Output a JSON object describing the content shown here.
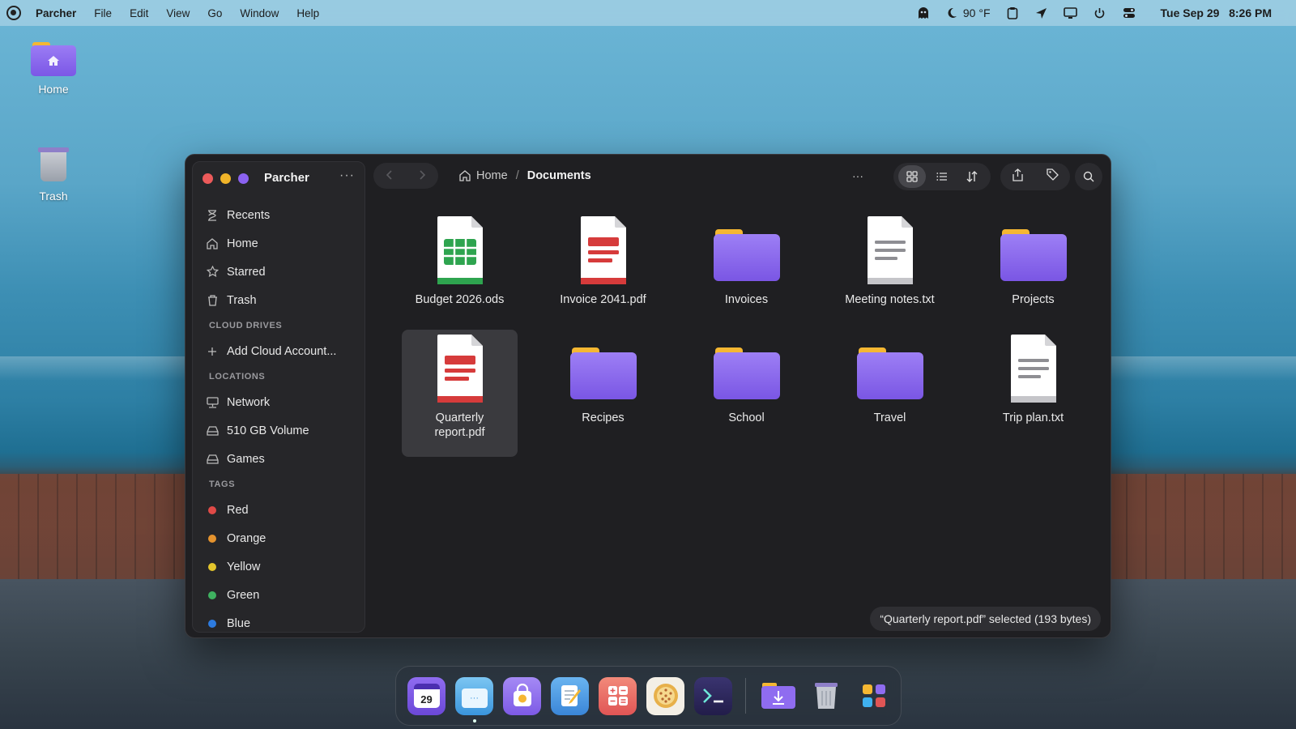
{
  "menubar": {
    "app": "Parcher",
    "menus": [
      "File",
      "Edit",
      "View",
      "Go",
      "Window",
      "Help"
    ],
    "weather": "90 °F",
    "clock_date": "Tue Sep 29",
    "clock_time": "8:26 PM"
  },
  "desktop": {
    "icons": [
      {
        "label": "Home",
        "icon": "home-folder-icon"
      },
      {
        "label": "Trash",
        "icon": "trash-icon"
      }
    ]
  },
  "window": {
    "title": "Parcher",
    "sidebar": {
      "places": [
        {
          "label": "Recents",
          "icon": "clock-icon"
        },
        {
          "label": "Home",
          "icon": "home-icon"
        },
        {
          "label": "Starred",
          "icon": "star-icon"
        },
        {
          "label": "Trash",
          "icon": "trash-icon"
        }
      ],
      "cloud_heading": "CLOUD DRIVES",
      "cloud_items": [
        {
          "label": "Add Cloud Account...",
          "icon": "plus-icon"
        }
      ],
      "locations_heading": "LOCATIONS",
      "locations": [
        {
          "label": "Network",
          "icon": "network-icon"
        },
        {
          "label": "510 GB Volume",
          "icon": "drive-icon"
        },
        {
          "label": "Games",
          "icon": "drive-icon"
        }
      ],
      "tags_heading": "TAGS",
      "tags": [
        {
          "label": "Red",
          "color": "#e04a47"
        },
        {
          "label": "Orange",
          "color": "#e5932e"
        },
        {
          "label": "Yellow",
          "color": "#e3c52c"
        },
        {
          "label": "Green",
          "color": "#3fb160"
        },
        {
          "label": "Blue",
          "color": "#2d7be0"
        }
      ]
    },
    "breadcrumb": {
      "home": "Home",
      "current": "Documents"
    },
    "files": [
      {
        "name": "Budget 2026.ods",
        "kind": "spreadsheet",
        "selected": false
      },
      {
        "name": "Invoice 2041.pdf",
        "kind": "pdf",
        "selected": false
      },
      {
        "name": "Invoices",
        "kind": "folder",
        "selected": false
      },
      {
        "name": "Meeting notes.txt",
        "kind": "text",
        "selected": false
      },
      {
        "name": "Projects",
        "kind": "folder",
        "selected": false
      },
      {
        "name": "Quarterly report.pdf",
        "kind": "pdf",
        "selected": true
      },
      {
        "name": "Recipes",
        "kind": "folder",
        "selected": false
      },
      {
        "name": "School",
        "kind": "folder",
        "selected": false
      },
      {
        "name": "Travel",
        "kind": "folder",
        "selected": false
      },
      {
        "name": "Trip plan.txt",
        "kind": "text",
        "selected": false
      }
    ],
    "status": "“Quarterly report.pdf” selected  (193 bytes)"
  },
  "dock": {
    "calendar_day": "29",
    "apps": [
      "calendar-app-icon",
      "files-app-icon",
      "app-store-icon",
      "text-editor-icon",
      "calculator-icon",
      "photos-icon",
      "terminal-icon",
      "downloads-folder-icon",
      "trash-icon",
      "app-grid-icon"
    ]
  }
}
